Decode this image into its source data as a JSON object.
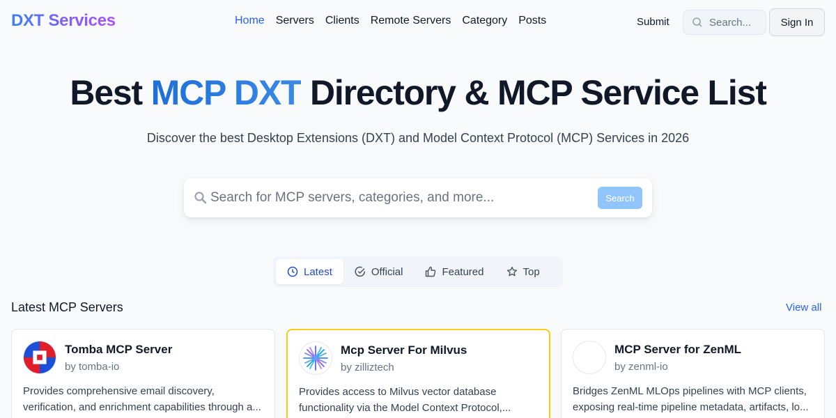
{
  "header": {
    "logo": "DXT Services",
    "nav": [
      "Home",
      "Servers",
      "Clients",
      "Remote Servers",
      "Category",
      "Posts"
    ],
    "submit": "Submit",
    "search_placeholder": "Search...",
    "signin": "Sign In"
  },
  "hero": {
    "title_before": "Best ",
    "title_accent": "MCP DXT",
    "title_after": " Directory & MCP Service List",
    "subtitle": "Discover the best Desktop Extensions (DXT) and Model Context Protocol (MCP) Services in 2026",
    "search_placeholder": "Search for MCP servers, categories, and more...",
    "search_button": "Search"
  },
  "tabs": [
    {
      "label": "Latest",
      "icon": "clock-icon",
      "active": true
    },
    {
      "label": "Official",
      "icon": "check-circle-icon"
    },
    {
      "label": "Featured",
      "icon": "thumbs-up-icon"
    },
    {
      "label": "Top",
      "icon": "star-icon"
    }
  ],
  "section": {
    "title": "Latest MCP Servers",
    "view_all": "View all"
  },
  "cards": [
    {
      "name": "Tomba MCP Server",
      "by": "by tomba-io",
      "desc": "Provides comprehensive email discovery, verification, and enrichment capabilities through a..."
    },
    {
      "name": "Mcp Server For Milvus",
      "by": "by zilliztech",
      "desc": "Provides access to Milvus vector database functionality via the Model Context Protocol,..."
    },
    {
      "name": "MCP Server for ZenML",
      "by": "by zenml-io",
      "desc": "Bridges ZenML MLOps pipelines with MCP clients, exposing real-time pipeline metadata, artifacts, lo..."
    }
  ],
  "colors": {
    "accent": "#2563eb",
    "search_button": "#93c5fd",
    "highlight_border": "#facc15"
  }
}
